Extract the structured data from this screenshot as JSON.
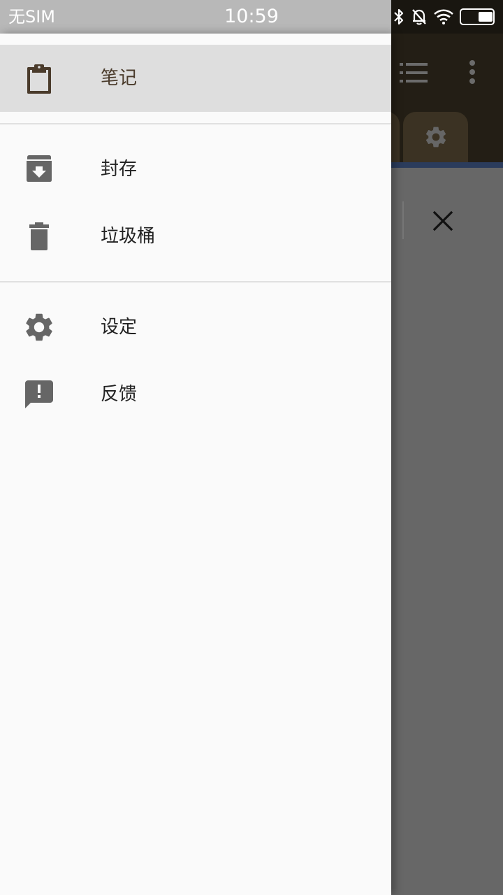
{
  "status_bar": {
    "carrier": "无SIM",
    "time": "10:59",
    "icons": [
      "bluetooth-icon",
      "mute-bell-icon",
      "wifi-icon",
      "battery-icon"
    ]
  },
  "drawer": {
    "groups": [
      [
        {
          "label": "笔记",
          "icon": "clipboard-icon",
          "active": true
        }
      ],
      [
        {
          "label": "封存",
          "icon": "archive-icon",
          "active": false
        },
        {
          "label": "垃圾桶",
          "icon": "trash-icon",
          "active": false
        }
      ],
      [
        {
          "label": "设定",
          "icon": "gear-icon",
          "active": false
        },
        {
          "label": "反馈",
          "icon": "feedback-icon",
          "active": false
        }
      ]
    ]
  },
  "background_app": {
    "toolbar_icons": [
      "list-view-icon",
      "more-vert-icon"
    ],
    "tab_icon": "gear-icon",
    "action_icon": "close-icon"
  },
  "colors": {
    "drawer_bg": "#fafafa",
    "active_item_bg": "#dedede",
    "active_item_accent": "#4a3b2b",
    "icon_gray": "#666666",
    "toolbar_dark": "#231e15",
    "scrim": "#676767"
  }
}
